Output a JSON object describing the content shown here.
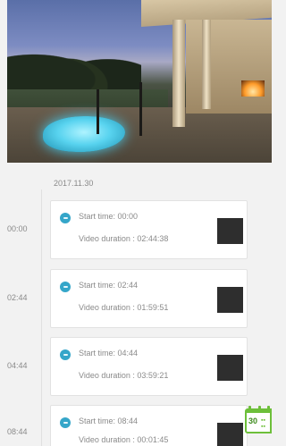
{
  "date_header": "2017.11.30",
  "recordings": [
    {
      "time_label": "00:00",
      "start": "Start time: 00:00",
      "duration": "Video duration : 02:44:38"
    },
    {
      "time_label": "02:44",
      "start": "Start time: 02:44",
      "duration": "Video duration : 01:59:51"
    },
    {
      "time_label": "04:44",
      "start": "Start time: 04:44",
      "duration": "Video duration : 03:59:21"
    },
    {
      "time_label": "08:44",
      "start": "Start time: 08:44",
      "duration": "Video duration : 00:01:45"
    }
  ],
  "calendar_button": {
    "day": "30",
    "icon": "calendar-icon"
  },
  "colors": {
    "accent": "#35a6c9",
    "calendar": "#6dbf3a",
    "thumbnail": "#2e2e2e",
    "background": "#f2f2f2"
  }
}
